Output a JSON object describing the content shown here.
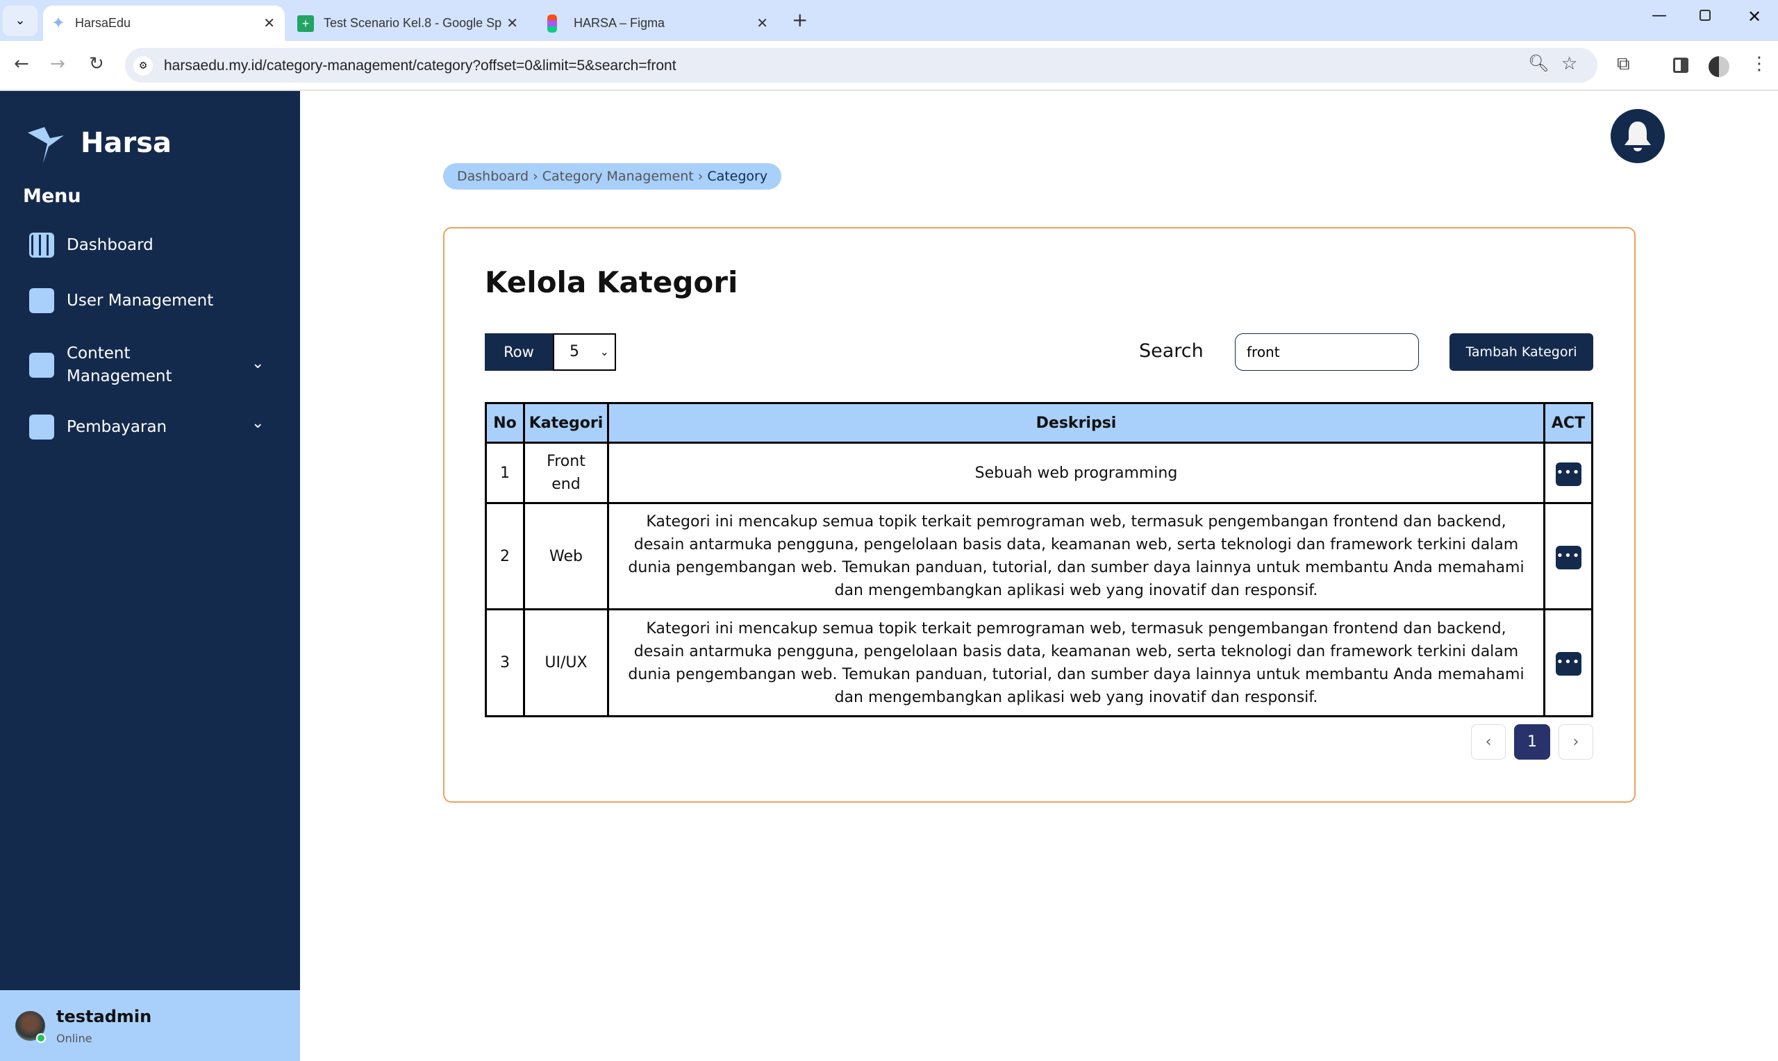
{
  "browser": {
    "tabs": [
      {
        "title": "HarsaEdu",
        "active": true
      },
      {
        "title": "Test Scenario Kel.8 - Google Sp"
      },
      {
        "title": "HARSA – Figma"
      }
    ],
    "url": "harsaedu.my.id/category-management/category?offset=0&limit=5&search=front"
  },
  "sidebar": {
    "brand": "Harsa",
    "menu_label": "Menu",
    "items": [
      {
        "label": "Dashboard",
        "icon": "grid-icon"
      },
      {
        "label": "User Management",
        "icon": "user-card-icon"
      },
      {
        "label": "Content Management",
        "icon": "documents-icon",
        "expandable": true
      },
      {
        "label": "Pembayaran",
        "icon": "card-icon",
        "expandable": true
      }
    ],
    "user": {
      "name": "testadmin",
      "status": "Online"
    }
  },
  "breadcrumb": [
    "Dashboard",
    "Category Management",
    "Category"
  ],
  "main": {
    "title": "Kelola Kategori",
    "row_label": "Row",
    "row_value": "5",
    "search_label": "Search",
    "search_value": "front",
    "add_button": "Tambah Kategori",
    "table": {
      "headers": [
        "No",
        "Kategori",
        "Deskripsi",
        "ACT"
      ],
      "rows": [
        {
          "no": "1",
          "kategori": "Front end",
          "deskripsi": "Sebuah web programming"
        },
        {
          "no": "2",
          "kategori": "Web",
          "deskripsi": "Kategori ini mencakup semua topik terkait pemrograman web, termasuk pengembangan frontend dan backend, desain antarmuka pengguna, pengelolaan basis data, keamanan web, serta teknologi dan framework terkini dalam dunia pengembangan web. Temukan panduan, tutorial, dan sumber daya lainnya untuk membantu Anda memahami dan mengembangkan aplikasi web yang inovatif dan responsif."
        },
        {
          "no": "3",
          "kategori": "UI/UX",
          "deskripsi": "Kategori ini mencakup semua topik terkait pemrograman web, termasuk pengembangan frontend dan backend, desain antarmuka pengguna, pengelolaan basis data, keamanan web, serta teknologi dan framework terkini dalam dunia pengembangan web. Temukan panduan, tutorial, dan sumber daya lainnya untuk membantu Anda memahami dan mengembangkan aplikasi web yang inovatif dan responsif."
        }
      ],
      "action_label": "•••"
    },
    "pagination": {
      "current": "1",
      "prev": "‹",
      "next": "›"
    }
  },
  "colors": {
    "navy": "#142a4d",
    "light_blue": "#a8d0fb",
    "card_border": "#eda25c",
    "page_active": "#28336b"
  }
}
